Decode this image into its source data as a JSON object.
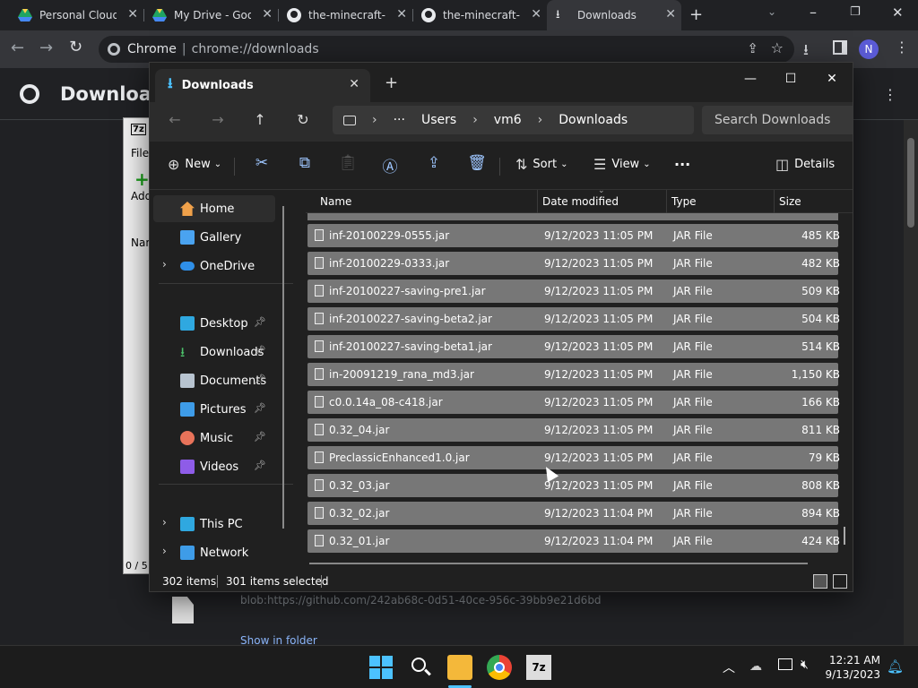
{
  "chrome": {
    "tabs": [
      {
        "title": "Personal Cloud S",
        "active": false
      },
      {
        "title": "My Drive - Goo",
        "active": false
      },
      {
        "title": "the-minecraft-m",
        "active": false
      },
      {
        "title": "the-minecraft-m",
        "active": false
      },
      {
        "title": "Downloads",
        "active": true
      }
    ],
    "omnibox_site": "Chrome",
    "omnibox_url": "chrome://downloads",
    "profile_initial": "N"
  },
  "downloads_page": {
    "title": "Downloads",
    "blob_url": "blob:https://github.com/242ab68c-0d51-40ce-956c-39bb9e21d6bd",
    "show_in_folder": "Show in folder"
  },
  "sevenzip": {
    "title": "7z",
    "menu_file": "File",
    "add": "Add",
    "col_name": "Nam",
    "status": "0 / 5"
  },
  "explorer": {
    "tab_title": "Downloads",
    "breadcrumb": [
      "Users",
      "vm6",
      "Downloads"
    ],
    "search_placeholder": "Search Downloads",
    "commands": {
      "new": "New",
      "sort": "Sort",
      "view": "View",
      "details": "Details"
    },
    "nav": {
      "home": "Home",
      "gallery": "Gallery",
      "onedrive": "OneDrive",
      "desktop": "Desktop",
      "downloads": "Downloads",
      "documents": "Documents",
      "pictures": "Pictures",
      "music": "Music",
      "videos": "Videos",
      "thispc": "This PC",
      "network": "Network"
    },
    "columns": {
      "name": "Name",
      "date": "Date modified",
      "type": "Type",
      "size": "Size"
    },
    "files": [
      {
        "name": "inf-20100229-0555.jar",
        "date": "9/12/2023 11:05 PM",
        "type": "JAR File",
        "size": "485 KB"
      },
      {
        "name": "inf-20100229-0333.jar",
        "date": "9/12/2023 11:05 PM",
        "type": "JAR File",
        "size": "482 KB"
      },
      {
        "name": "inf-20100227-saving-pre1.jar",
        "date": "9/12/2023 11:05 PM",
        "type": "JAR File",
        "size": "509 KB"
      },
      {
        "name": "inf-20100227-saving-beta2.jar",
        "date": "9/12/2023 11:05 PM",
        "type": "JAR File",
        "size": "504 KB"
      },
      {
        "name": "inf-20100227-saving-beta1.jar",
        "date": "9/12/2023 11:05 PM",
        "type": "JAR File",
        "size": "514 KB"
      },
      {
        "name": "in-20091219_rana_md3.jar",
        "date": "9/12/2023 11:05 PM",
        "type": "JAR File",
        "size": "1,150 KB"
      },
      {
        "name": "c0.0.14a_08-c418.jar",
        "date": "9/12/2023 11:05 PM",
        "type": "JAR File",
        "size": "166 KB"
      },
      {
        "name": "0.32_04.jar",
        "date": "9/12/2023 11:05 PM",
        "type": "JAR File",
        "size": "811 KB"
      },
      {
        "name": "PreclassicEnhanced1.0.jar",
        "date": "9/12/2023 11:05 PM",
        "type": "JAR File",
        "size": "79 KB"
      },
      {
        "name": "0.32_03.jar",
        "date": "9/12/2023 11:05 PM",
        "type": "JAR File",
        "size": "808 KB"
      },
      {
        "name": "0.32_02.jar",
        "date": "9/12/2023 11:04 PM",
        "type": "JAR File",
        "size": "894 KB"
      },
      {
        "name": "0.32_01.jar",
        "date": "9/12/2023 11:04 PM",
        "type": "JAR File",
        "size": "424 KB"
      }
    ],
    "status": {
      "items": "302 items",
      "selected": "301 items selected"
    }
  },
  "taskbar": {
    "time": "12:21 AM",
    "date": "9/13/2023"
  },
  "colors": {
    "accent": "#0078d4",
    "selection": "#777777",
    "chrome_bg": "#202124"
  }
}
